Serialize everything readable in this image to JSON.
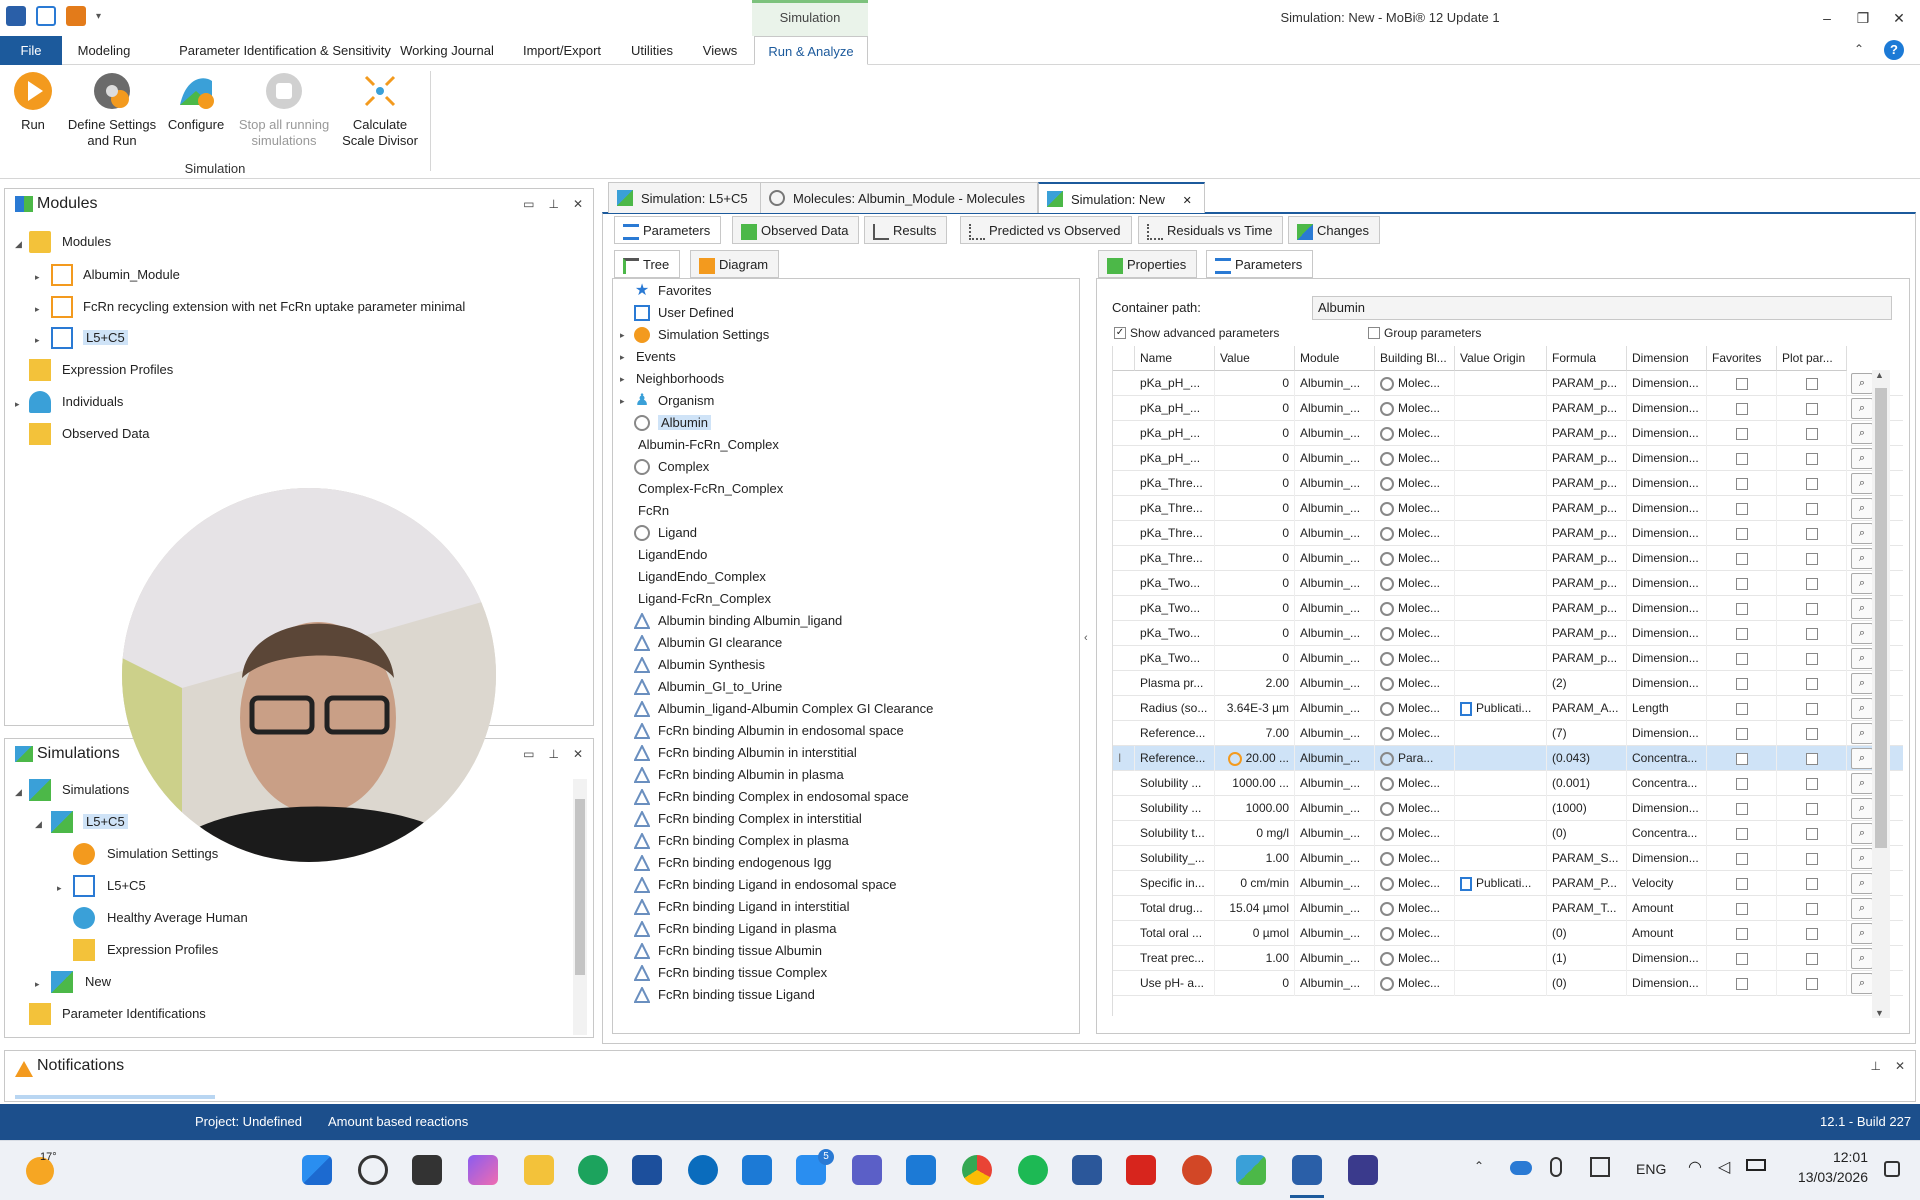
{
  "window": {
    "title": "Simulation: New - MoBi® 12 Update 1",
    "context_tab": "Simulation",
    "minimize": "–",
    "restore": "❐",
    "close": "✕"
  },
  "menu": {
    "file": "File",
    "tabs": [
      "Modeling",
      "Parameter Identification & Sensitivity",
      "Working Journal",
      "Import/Export",
      "Utilities",
      "Views",
      "Run & Analyze"
    ]
  },
  "ribbon": {
    "run": "Run",
    "define_settings_1": "Define Settings",
    "define_settings_2": "and Run",
    "configure": "Configure",
    "stop_1": "Stop all running",
    "stop_2": "simulations",
    "calc_1": "Calculate",
    "calc_2": "Scale Divisor",
    "group": "Simulation"
  },
  "modules_panel": {
    "title": "Modules",
    "root": "Modules",
    "items": [
      "Albumin_Module",
      "FcRn recycling extension with net FcRn uptake parameter minimal",
      "L5+C5"
    ],
    "other": [
      "Expression Profiles",
      "Individuals",
      "Observed Data"
    ]
  },
  "simulations_panel": {
    "title": "Simulations",
    "root": "Simulations",
    "sim": "L5+C5",
    "children": [
      "Simulation Settings",
      "L5+C5",
      "Healthy Average Human",
      "Expression Profiles"
    ],
    "new": "New",
    "param_ids": "Parameter Identifications"
  },
  "notifications": {
    "title": "Notifications"
  },
  "doc_tabs": [
    "Simulation: L5+C5",
    "Molecules: Albumin_Module - Molecules",
    "Simulation: New"
  ],
  "sub_tabs": [
    "Parameters",
    "Observed Data",
    "Results",
    "Predicted vs Observed",
    "Residuals vs Time",
    "Changes"
  ],
  "view_tabs": [
    "Tree",
    "Diagram"
  ],
  "tree": {
    "top": [
      "Favorites",
      "User Defined",
      "Simulation Settings",
      "Events",
      "Neighborhoods",
      "Organism",
      "Albumin"
    ],
    "molecules": [
      "Albumin-FcRn_Complex",
      "Complex",
      "Complex-FcRn_Complex",
      "FcRn",
      "Ligand",
      "LigandEndo",
      "LigandEndo_Complex",
      "Ligand-FcRn_Complex"
    ],
    "reactions": [
      "Albumin binding Albumin_ligand",
      "Albumin GI clearance",
      "Albumin Synthesis",
      "Albumin_GI_to_Urine",
      "Albumin_ligand-Albumin Complex GI Clearance",
      "FcRn binding Albumin in endosomal space",
      "FcRn binding Albumin in interstitial",
      "FcRn binding Albumin in plasma",
      "FcRn binding Complex in endosomal space",
      "FcRn binding Complex in interstitial",
      "FcRn binding Complex in plasma",
      "FcRn binding endogenous Igg",
      "FcRn binding Ligand in endosomal space",
      "FcRn binding Ligand in interstitial",
      "FcRn binding Ligand in plasma",
      "FcRn binding tissue Albumin",
      "FcRn binding tissue Complex",
      "FcRn binding tissue Ligand"
    ]
  },
  "props_tabs": [
    "Properties",
    "Parameters"
  ],
  "container_path_label": "Container path:",
  "container_path_value": "Albumin",
  "show_advanced": "Show advanced parameters",
  "group_params": "Group parameters",
  "grid": {
    "columns": [
      "Name",
      "Value",
      "Module",
      "Building Bl...",
      "Value Origin",
      "Formula",
      "Dimension",
      "Favorites",
      "Plot par..."
    ],
    "rows": [
      [
        "pKa_pH_...",
        "0",
        "Albumin_...",
        "Molec...",
        "",
        "PARAM_p...",
        "Dimension..."
      ],
      [
        "pKa_pH_...",
        "0",
        "Albumin_...",
        "Molec...",
        "",
        "PARAM_p...",
        "Dimension..."
      ],
      [
        "pKa_pH_...",
        "0",
        "Albumin_...",
        "Molec...",
        "",
        "PARAM_p...",
        "Dimension..."
      ],
      [
        "pKa_pH_...",
        "0",
        "Albumin_...",
        "Molec...",
        "",
        "PARAM_p...",
        "Dimension..."
      ],
      [
        "pKa_Thre...",
        "0",
        "Albumin_...",
        "Molec...",
        "",
        "PARAM_p...",
        "Dimension..."
      ],
      [
        "pKa_Thre...",
        "0",
        "Albumin_...",
        "Molec...",
        "",
        "PARAM_p...",
        "Dimension..."
      ],
      [
        "pKa_Thre...",
        "0",
        "Albumin_...",
        "Molec...",
        "",
        "PARAM_p...",
        "Dimension..."
      ],
      [
        "pKa_Thre...",
        "0",
        "Albumin_...",
        "Molec...",
        "",
        "PARAM_p...",
        "Dimension..."
      ],
      [
        "pKa_Two...",
        "0",
        "Albumin_...",
        "Molec...",
        "",
        "PARAM_p...",
        "Dimension..."
      ],
      [
        "pKa_Two...",
        "0",
        "Albumin_...",
        "Molec...",
        "",
        "PARAM_p...",
        "Dimension..."
      ],
      [
        "pKa_Two...",
        "0",
        "Albumin_...",
        "Molec...",
        "",
        "PARAM_p...",
        "Dimension..."
      ],
      [
        "pKa_Two...",
        "0",
        "Albumin_...",
        "Molec...",
        "",
        "PARAM_p...",
        "Dimension..."
      ],
      [
        "Plasma pr...",
        "2.00",
        "Albumin_...",
        "Molec...",
        "",
        "(2)",
        "Dimension..."
      ],
      [
        "Radius (so...",
        "3.64E-3 µm",
        "Albumin_...",
        "Molec...",
        "Publicati...",
        "PARAM_A...",
        "Length"
      ],
      [
        "Reference...",
        "7.00",
        "Albumin_...",
        "Molec...",
        "",
        "(7)",
        "Dimension..."
      ],
      [
        "Reference...",
        "20.00 ...",
        "Albumin_...",
        "Para...",
        "",
        "(0.043)",
        "Concentra..."
      ],
      [
        "Solubility ...",
        "1000.00 ...",
        "Albumin_...",
        "Molec...",
        "",
        "(0.001)",
        "Concentra..."
      ],
      [
        "Solubility ...",
        "1000.00",
        "Albumin_...",
        "Molec...",
        "",
        "(1000)",
        "Dimension..."
      ],
      [
        "Solubility t...",
        "0 mg/l",
        "Albumin_...",
        "Molec...",
        "",
        "(0)",
        "Concentra..."
      ],
      [
        "Solubility_...",
        "1.00",
        "Albumin_...",
        "Molec...",
        "",
        "PARAM_S...",
        "Dimension..."
      ],
      [
        "Specific in...",
        "0 cm/min",
        "Albumin_...",
        "Molec...",
        "Publicati...",
        "PARAM_P...",
        "Velocity"
      ],
      [
        "Total drug...",
        "15.04 µmol",
        "Albumin_...",
        "Molec...",
        "",
        "PARAM_T...",
        "Amount"
      ],
      [
        "Total oral ...",
        "0 µmol",
        "Albumin_...",
        "Molec...",
        "",
        "(0)",
        "Amount"
      ],
      [
        "Treat prec...",
        "1.00",
        "Albumin_...",
        "Molec...",
        "",
        "(1)",
        "Dimension..."
      ],
      [
        "Use pH- a...",
        "0",
        "Albumin_...",
        "Molec...",
        "",
        "(0)",
        "Dimension..."
      ]
    ]
  },
  "status": {
    "project": "Project: Undefined",
    "reactions": "Amount based reactions",
    "build": "12.1 - Build 227"
  },
  "taskbar": {
    "temp": "17°",
    "lang": "ENG",
    "time": "12:01",
    "date": "13/03/2026",
    "badge": "5"
  },
  "colors": {
    "accent": "#1c5a9c",
    "status": "#1c4f8c",
    "selection": "#cfe3f7"
  }
}
